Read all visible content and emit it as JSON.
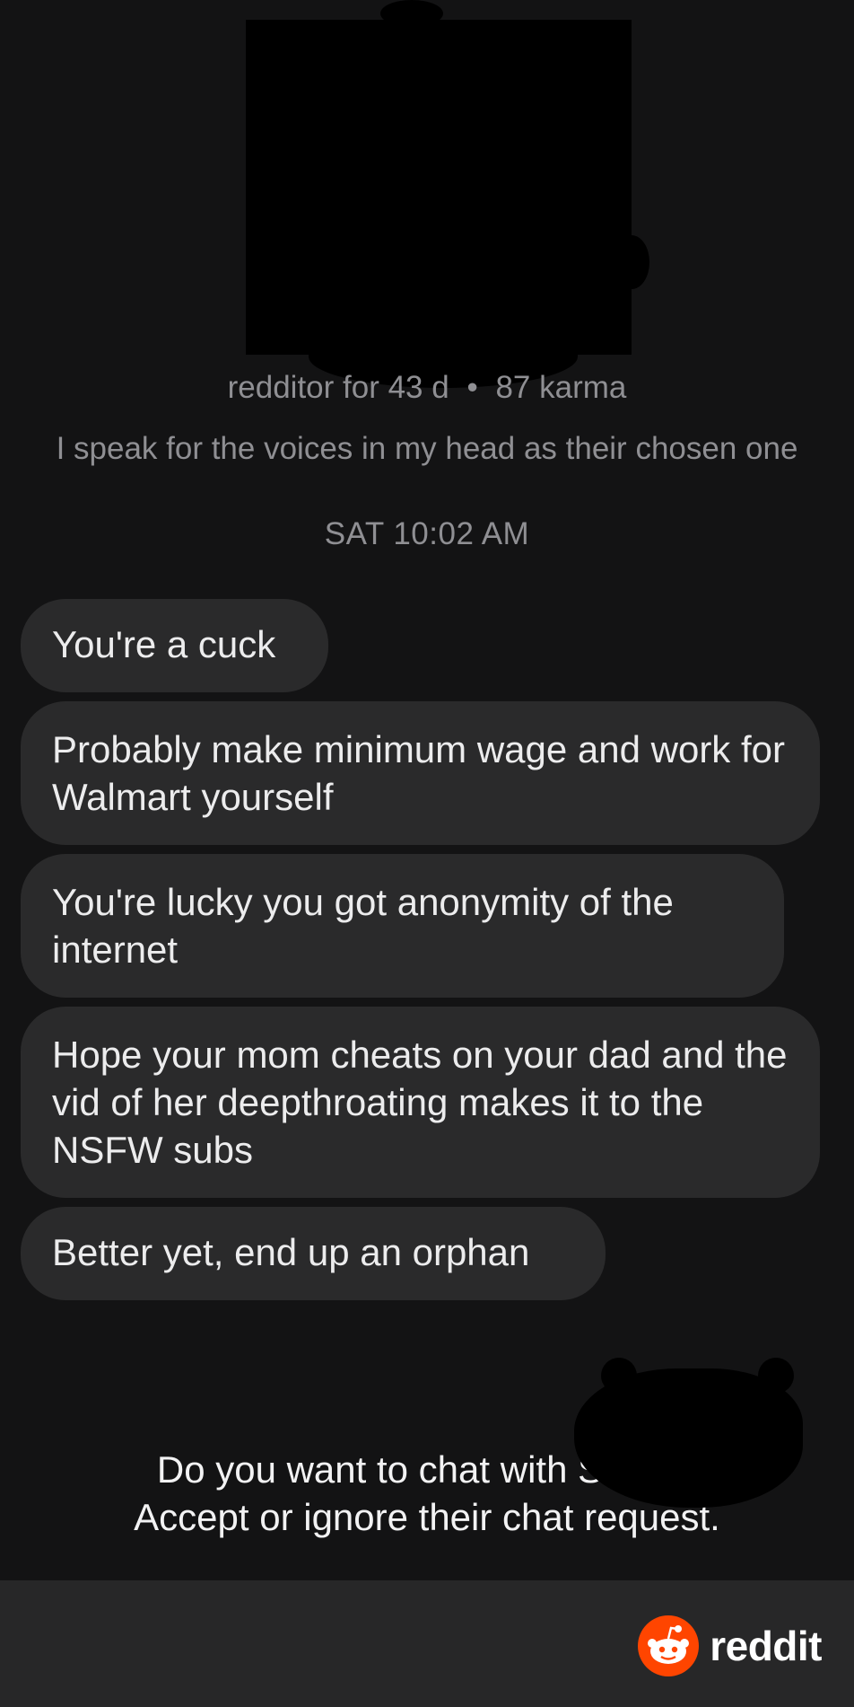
{
  "profile": {
    "age": "redditor for 43 d",
    "separator": "•",
    "karma": "87 karma",
    "bio": "I speak for the voices in my head as their chosen one"
  },
  "timestamp": "SAT 10:02 AM",
  "messages": [
    {
      "text": "You're a cuck"
    },
    {
      "text": "Probably make minimum wage and work for Walmart yourself"
    },
    {
      "text": "You're lucky you got anonymity of the internet"
    },
    {
      "text": "Hope your mom cheats on your dad and the vid of her deepthroating makes it to the NSFW subs"
    },
    {
      "text": "Better yet, end up an orphan"
    }
  ],
  "chat_request": {
    "line1": "Do you want to chat with S        .",
    "line2": "Accept or ignore their chat request."
  },
  "footer": {
    "brand": "reddit",
    "icon": "snoo-icon",
    "brand_color": "#ff4500"
  }
}
